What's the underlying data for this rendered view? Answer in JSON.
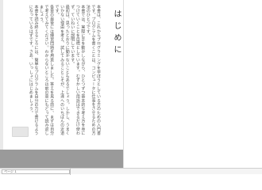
{
  "chapter": {
    "title": "はじめに"
  },
  "body": {
    "paragraphs": [
      "本書は、これからプログラミングを学ぼうとしている方のための入門書です。プログラムを書くことは、コンピュータに仕事をさせるための方法のひとつです。",
      "本書では、実際に手を動かしながら、ひとつずつ基本的な考え方を身につけていくことを目標としています。むずかしい用語はできるだけ使わず、ていねいに説明しています。",
      "最初は、思ったとおりに動かないこともあるでしょう。しかし、うまくいかない理由を考え、試してみることこそが、上達へのいちばんの近道です。",
      "各章の最後には練習問題を用意しました。答えを見る前に、まずは自分で考えてみてください。わからないところは前の章にもどって読み返しましょう。",
      "本書を読み終えるころには、簡単なプログラムを自分の力で書けるようになっているはずです。さあ、いっしょにはじめましょう。"
    ]
  },
  "controls": {
    "next_button_label": "",
    "bottom_input_value": "ページ 1"
  }
}
